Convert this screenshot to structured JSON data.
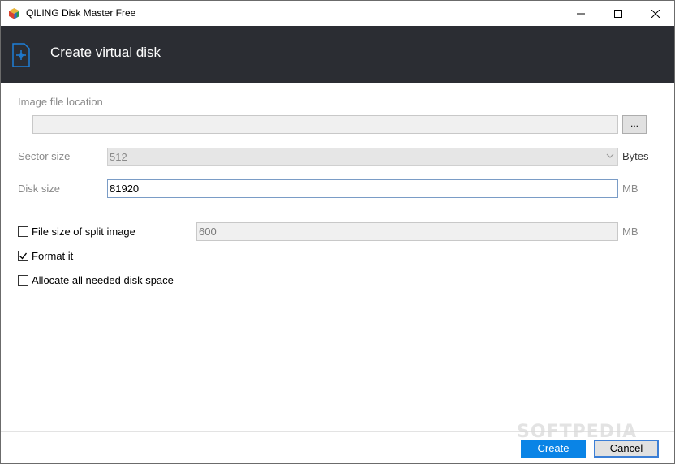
{
  "window": {
    "title": "QILING Disk Master Free",
    "controls": {
      "minimize": "—",
      "maximize": "☐",
      "close": "✕"
    }
  },
  "header": {
    "title": "Create virtual disk",
    "icon": "virtual-disk-icon"
  },
  "form": {
    "image_location": {
      "label": "Image file location",
      "value": "",
      "browse_label": "..."
    },
    "sector_size": {
      "label": "Sector size",
      "value": "512",
      "unit": "Bytes"
    },
    "disk_size": {
      "label": "Disk size",
      "value": "81920",
      "unit": "MB"
    },
    "split_image": {
      "label": "File size of split image",
      "checked": false,
      "value": "600",
      "unit": "MB"
    },
    "format_it": {
      "label": "Format it",
      "checked": true
    },
    "allocate": {
      "label": "Allocate all needed disk space",
      "checked": false
    }
  },
  "footer": {
    "create_label": "Create",
    "cancel_label": "Cancel"
  },
  "watermark": "SOFTPEDIA",
  "colors": {
    "header_bg": "#2b2d33",
    "accent": "#0a84e6",
    "icon_blue": "#1e7fd8"
  }
}
